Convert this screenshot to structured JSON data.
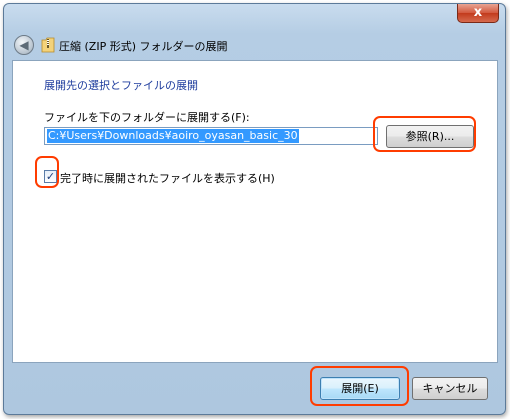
{
  "window": {
    "title": "圧縮 (ZIP 形式) フォルダーの展開",
    "close_label": "x"
  },
  "content": {
    "heading": "展開先の選択とファイルの展開",
    "field_label": "ファイルを下のフォルダーに展開する(F):",
    "path_value": "C:¥Users¥Downloads¥aoiro_oyasan_basic_30",
    "browse_label": "参照(R)...",
    "checkbox_label": "完了時に展開されたファイルを表示する(H)",
    "checkbox_checked": true,
    "checkbox_mark": "✓"
  },
  "footer": {
    "extract_label": "展開(E)",
    "cancel_label": "キャンセル"
  },
  "icons": {
    "back": "back-arrow-icon",
    "folder": "zip-folder-icon"
  },
  "colors": {
    "heading": "#1f3d9e",
    "selection": "#3399ff",
    "annotation": "#ff3c00"
  }
}
